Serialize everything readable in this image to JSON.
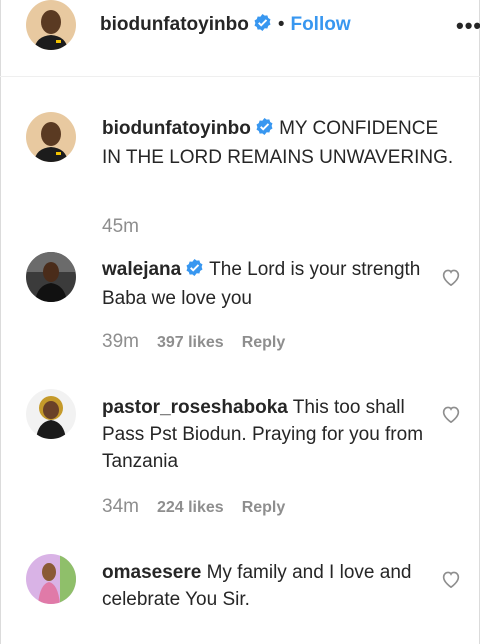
{
  "header": {
    "username": "biodunfatoyinbo",
    "separator": "•",
    "follow_label": "Follow",
    "more_label": "•••"
  },
  "caption": {
    "username": "biodunfatoyinbo",
    "text": "MY CONFIDENCE IN THE LORD REMAINS UNWAVERING.",
    "time": "45m"
  },
  "comments": [
    {
      "username": "walejana",
      "verified": true,
      "text": "The Lord is your strength Baba we love you",
      "time": "39m",
      "likes": "397 likes",
      "reply": "Reply"
    },
    {
      "username": "pastor_roseshaboka",
      "verified": false,
      "text": "This too shall Pass Pst Biodun. Praying for you from Tanzania",
      "time": "34m",
      "likes": "224 likes",
      "reply": "Reply"
    },
    {
      "username": "omasesere",
      "verified": false,
      "text": "My family and I love and celebrate You Sir.",
      "time": "",
      "likes": "",
      "reply": ""
    }
  ],
  "colors": {
    "accent": "#3897f0",
    "text": "#262626",
    "muted": "#8e8e8e",
    "verified": "#3897f0"
  },
  "icons": {
    "verified": "verified-badge-icon",
    "like": "heart-icon",
    "more": "more-options-icon"
  }
}
